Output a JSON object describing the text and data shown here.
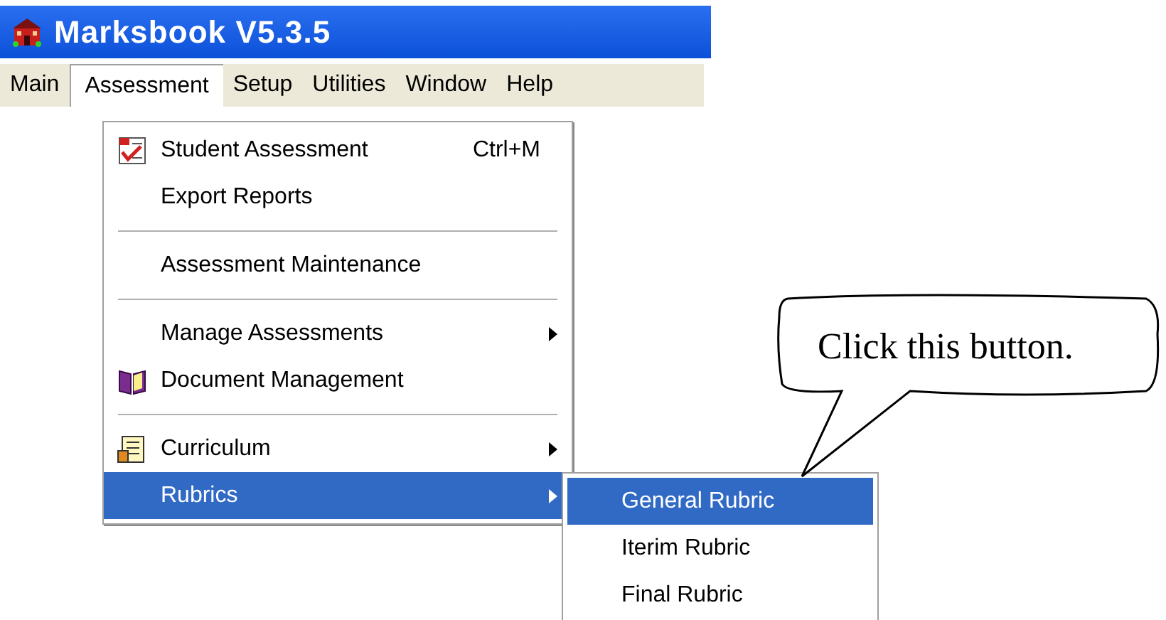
{
  "window": {
    "title": "Marksbook V5.3.5"
  },
  "menu_bar": [
    {
      "label": "Main",
      "selected": false
    },
    {
      "label": "Assessment",
      "selected": true
    },
    {
      "label": "Setup",
      "selected": false
    },
    {
      "label": "Utilities",
      "selected": false
    },
    {
      "label": "Window",
      "selected": false
    },
    {
      "label": "Help",
      "selected": false
    }
  ],
  "menu": [
    {
      "kind": "item",
      "label": "Student Assessment",
      "shortcut": "Ctrl+M",
      "submenu": false,
      "selected": false
    },
    {
      "kind": "item",
      "label": "Export Reports",
      "submenu": false,
      "selected": false
    },
    {
      "kind": "separator"
    },
    {
      "kind": "item",
      "label": "Assessment Maintenance",
      "submenu": false,
      "selected": false
    },
    {
      "kind": "separator"
    },
    {
      "kind": "item",
      "label": "Manage Assessments",
      "submenu": true,
      "selected": false
    },
    {
      "kind": "item",
      "label": "Document Management",
      "submenu": false,
      "selected": false
    },
    {
      "kind": "separator"
    },
    {
      "kind": "item",
      "label": "Curriculum",
      "submenu": true,
      "selected": false
    },
    {
      "kind": "item",
      "label": "Rubrics",
      "submenu": true,
      "selected": true
    }
  ],
  "submenu": [
    {
      "label": "General Rubric",
      "selected": true
    },
    {
      "label": "Iterim Rubric",
      "selected": false
    },
    {
      "label": "Final Rubric",
      "selected": false
    }
  ],
  "callout": {
    "text": "Click this button."
  }
}
